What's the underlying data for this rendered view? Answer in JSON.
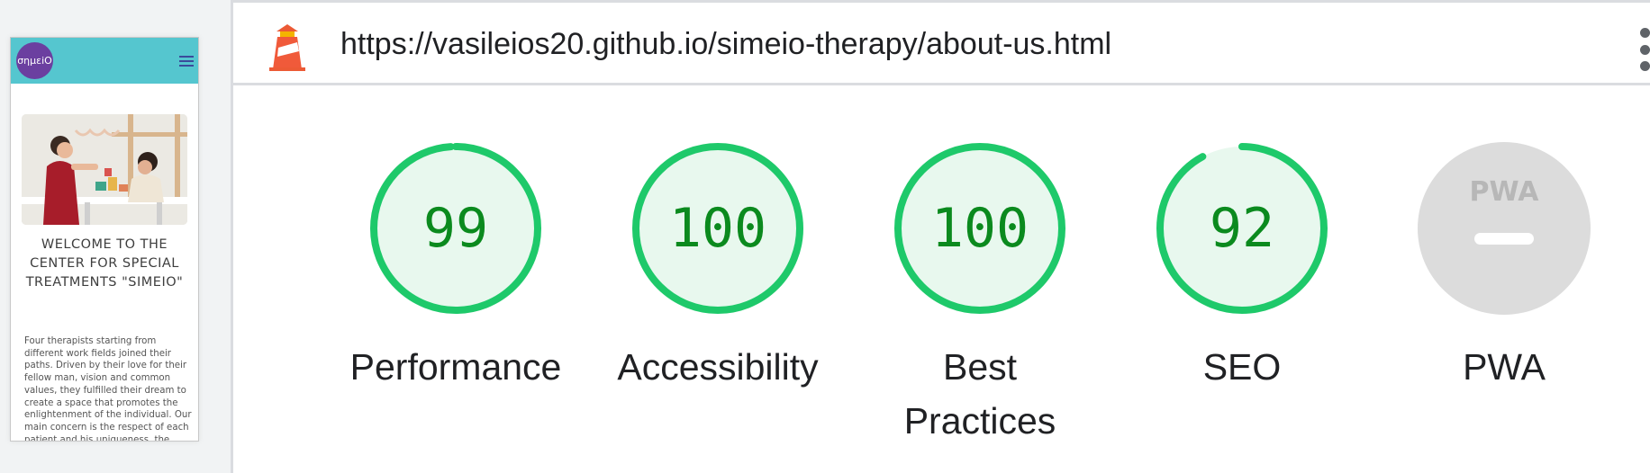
{
  "preview": {
    "logo_text": "σημεiΟ",
    "title": "WELCOME TO THE CENTER FOR SPECIAL TREATMENTS \"SIMEIO\"",
    "body": "Four therapists starting from different work fields joined their paths. Driven by their love for their fellow man, vision and common values, they fulfilled their dream to create a space that promotes the enlightenment of the individual. Our main concern is the respect of each patient and his uniqueness, the inclusion of all"
  },
  "report": {
    "url": "https://vasileios20.github.io/simeio-therapy/about-us.html"
  },
  "categories": [
    {
      "label": "Performance",
      "score": "99",
      "value": 0.99,
      "color": "#1ec96a"
    },
    {
      "label": "Accessibility",
      "score": "100",
      "value": 1.0,
      "color": "#1ec96a"
    },
    {
      "label": "Best Practices",
      "score": "100",
      "value": 1.0,
      "color": "#1ec96a"
    },
    {
      "label": "SEO",
      "score": "92",
      "value": 0.92,
      "color": "#1ec96a"
    }
  ],
  "pwa": {
    "label": "PWA",
    "badge": "PWA",
    "color": "#cbcbcb"
  },
  "colors": {
    "pass_fill": "#e8f8ee",
    "pass_stroke": "#1ec96a",
    "pass_text": "#0b8a1e"
  }
}
